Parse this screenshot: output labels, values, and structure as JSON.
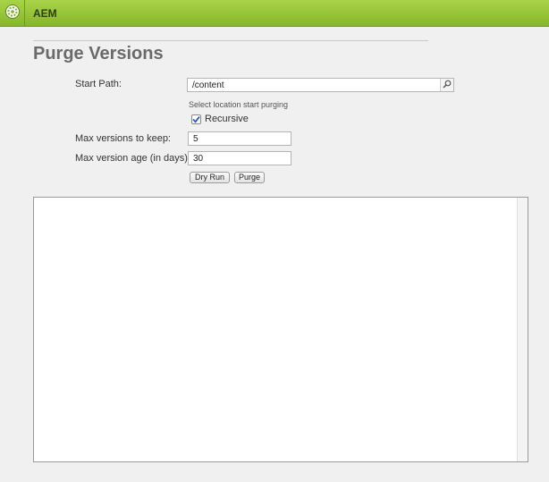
{
  "app": {
    "title": "AEM",
    "logo_icon": "adobe-experience-manager-logo-icon"
  },
  "page": {
    "title": "Purge Versions"
  },
  "form": {
    "start_path": {
      "label": "Start Path:",
      "value": "/content",
      "hint": "Select location start purging",
      "browse_icon": "search-icon"
    },
    "recursive": {
      "label": "Recursive",
      "checked": true
    },
    "max_versions": {
      "label": "Max versions to keep:",
      "value": "5"
    },
    "max_age": {
      "label": "Max version age (in days):",
      "value": "30"
    },
    "buttons": {
      "dry_run": "Dry Run",
      "purge": "Purge"
    }
  },
  "theme": {
    "accent": "#8fbc33",
    "title_color": "#6a6a6a"
  }
}
